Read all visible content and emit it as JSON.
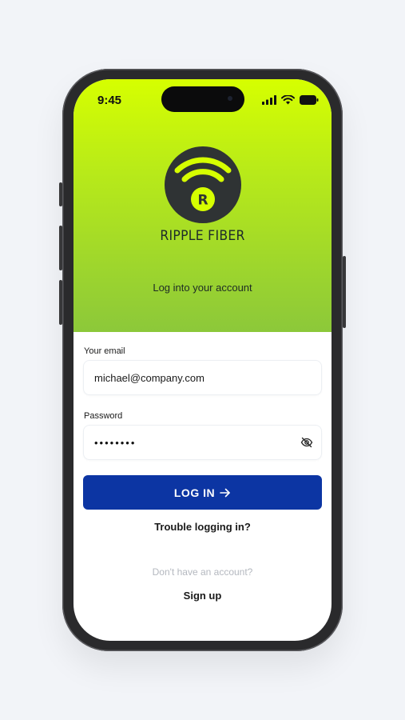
{
  "status_bar": {
    "time": "9:45",
    "icons": [
      "cellular-signal-icon",
      "wifi-icon",
      "battery-icon"
    ]
  },
  "brand": {
    "logo_letter": "R",
    "name": "RIPPLE FIBER",
    "accent_color": "#d6ff00",
    "logo_bg": "#2f3334"
  },
  "login": {
    "subtitle": "Log into your account",
    "email_label": "Your email",
    "email_value": "michael@company.com",
    "password_label": "Password",
    "password_mask": "••••••••",
    "password_toggle_icon": "eye-off-icon",
    "submit_label": "LOG IN",
    "submit_icon": "arrow-right-icon",
    "submit_color": "#0c35a3",
    "trouble_link": "Trouble logging in?",
    "no_account_text": "Don't have an account?",
    "signup_link": "Sign up"
  }
}
